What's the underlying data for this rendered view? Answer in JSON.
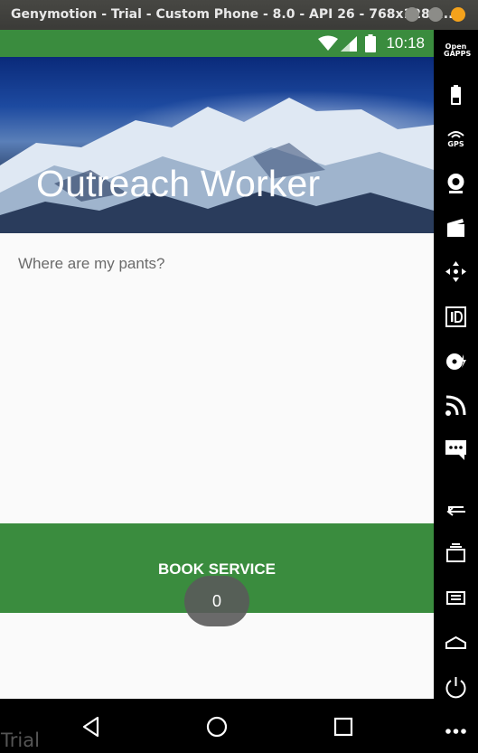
{
  "window": {
    "title": "Genymotion - Trial - Custom Phone - 8.0 - API 26 - 768x1280...",
    "close_color": "#f4a21c"
  },
  "statusbar": {
    "time": "10:18",
    "icons": [
      "wifi-icon",
      "signal-icon",
      "battery-icon"
    ],
    "color": "#3a8c3e"
  },
  "app": {
    "header_title": "Outreach Worker",
    "question": "Where are my pants?",
    "book_service_label": "BOOK SERVICE",
    "toast_text": "0",
    "accent_color": "#3a8c3e"
  },
  "navbar": {
    "buttons": [
      "back-icon",
      "home-icon",
      "recents-icon"
    ],
    "watermark": "Trial"
  },
  "sidebar": {
    "opengapps_label": "Open GAPPS",
    "gps_label": "GPS",
    "buttons": [
      "opengapps-icon",
      "battery-icon",
      "gps-icon",
      "camera-icon",
      "media-icon",
      "dpad-icon",
      "device-id-icon",
      "disk-icon",
      "cast-icon",
      "sms-icon",
      "back-icon",
      "recents-icon",
      "menu-icon",
      "home-icon",
      "power-icon",
      "more-icon"
    ]
  }
}
